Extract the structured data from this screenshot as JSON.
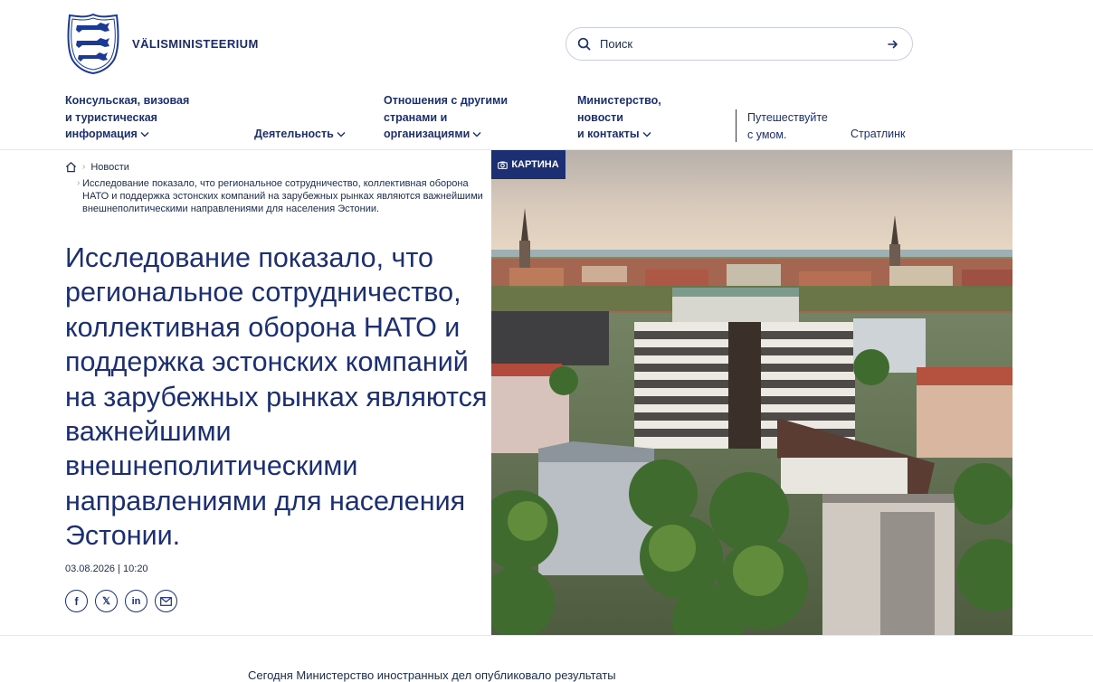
{
  "header": {
    "logo_text": "VÄLISMINISTEERIUM",
    "search": {
      "placeholder": "Поиск"
    }
  },
  "nav": {
    "consular": [
      "Консульская, визовая",
      "и туристическая",
      "информация"
    ],
    "activities": "Деятельность",
    "relations": [
      "Отношения с другими",
      "странами и",
      "организациями"
    ],
    "ministry": [
      "Министерство,",
      "новости",
      "и контакты"
    ],
    "travel": [
      "Путешествуйте",
      "с умом."
    ],
    "stratlink": "Стратлинк"
  },
  "breadcrumb": {
    "parent": "Новости",
    "current": "Исследование показало, что региональное сотрудничество, коллективная оборона НАТО и поддержка эстонских компаний на зарубежных рынках являются важнейшими внешнеполитическими направлениями для населения Эстонии."
  },
  "article": {
    "title": "Исследование показало, что региональное сотрудничество, коллективная оборона НАТО и поддержка эстонских компаний на зарубежных рынках являются важнейшими внешнеполитическими направлениями для населения Эстонии.",
    "date": "03.08.2026 | 10:20",
    "image_badge": "КАРТИНА",
    "body_start": "Сегодня Министерство иностранных дел опубликовало результаты"
  },
  "share": {
    "facebook": "f",
    "x": "𝕏",
    "linkedin": "in"
  },
  "colors": {
    "brand": "#1b2f72",
    "text": "#1a2b4b",
    "rule": "#e4e7ee"
  }
}
